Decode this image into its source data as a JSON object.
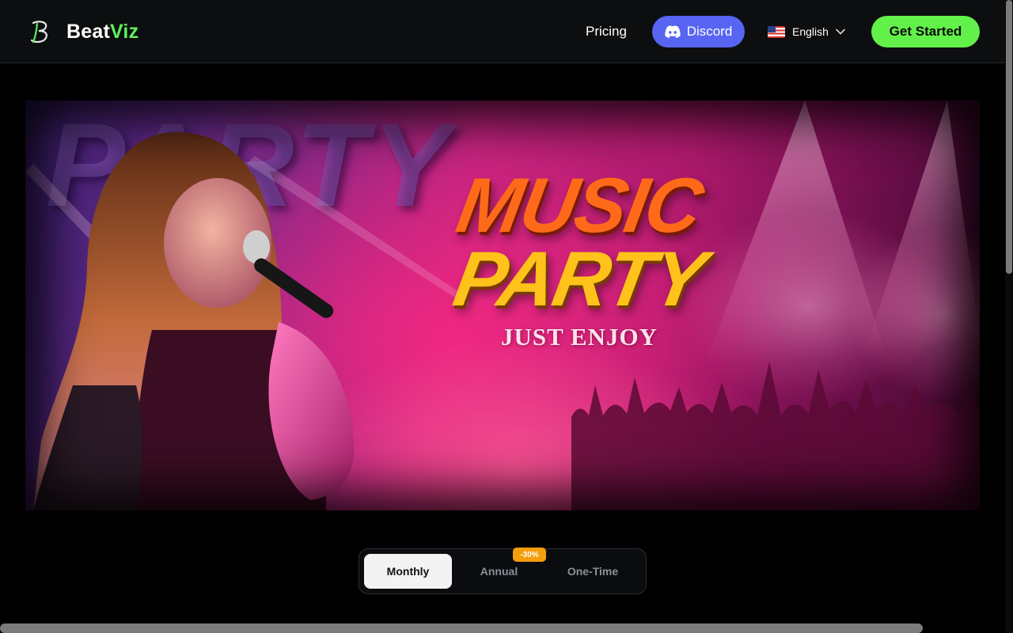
{
  "header": {
    "brand_part1": "Beat",
    "brand_part2": "Viz",
    "nav_pricing": "Pricing",
    "discord_label": "Discord",
    "language_label": "English",
    "language_flag_icon": "us-flag-icon",
    "cta_label": "Get Started"
  },
  "hero": {
    "background_word": "PARTY",
    "title_line1": "MUSIC",
    "title_line2": "PARTY",
    "tagline": "JUST ENJOY"
  },
  "billing": {
    "tabs": [
      {
        "label": "Monthly",
        "active": true
      },
      {
        "label": "Annual",
        "active": false
      },
      {
        "label": "One-Time",
        "active": false
      }
    ],
    "annual_badge": "-30%"
  },
  "colors": {
    "accent_green": "#62f14a",
    "brand_green": "#5cf25a",
    "discord_blue": "#5865f2",
    "badge_orange": "#f59e0b"
  }
}
